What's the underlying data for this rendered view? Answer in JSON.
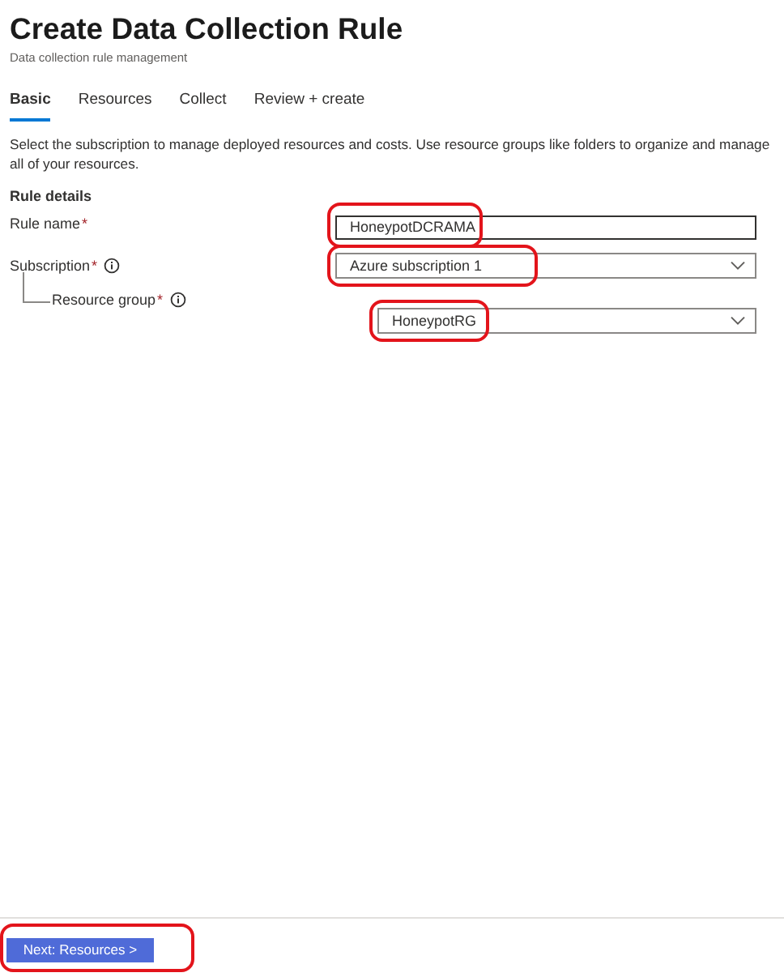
{
  "header": {
    "title": "Create Data Collection Rule",
    "subtitle": "Data collection rule management"
  },
  "tabs": [
    {
      "label": "Basic",
      "selected": true
    },
    {
      "label": "Resources",
      "selected": false
    },
    {
      "label": "Collect",
      "selected": false
    },
    {
      "label": "Review + create",
      "selected": false
    }
  ],
  "description": "Select the subscription to manage deployed resources and costs. Use resource groups like folders to organize and manage all of your resources.",
  "section_title": "Rule details",
  "fields": [
    {
      "kind": "text",
      "label": "Rule name",
      "required_mark": "*",
      "info": false,
      "nested": false,
      "value": "HoneypotDCRAMA",
      "highlighted": true
    },
    {
      "kind": "select",
      "label": "Subscription",
      "required_mark": "*",
      "info": true,
      "nested": false,
      "value": "Azure subscription 1",
      "highlighted": true
    },
    {
      "kind": "select",
      "label": "Resource group",
      "required_mark": "*",
      "info": true,
      "nested": true,
      "value": "HoneypotRG",
      "highlighted": true
    }
  ],
  "footer": {
    "button": {
      "label": "Next: Resources >",
      "highlighted": true
    }
  }
}
